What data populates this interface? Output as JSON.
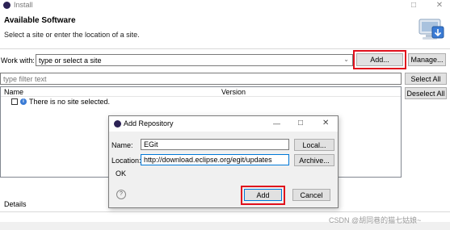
{
  "window": {
    "title": "Install",
    "minimize_glyph": "□",
    "close_glyph": "✕"
  },
  "header": {
    "title": "Available Software",
    "subtitle": "Select a site or enter the location of a site."
  },
  "workwith": {
    "label": "Work with:",
    "value": "type or select a site",
    "add_label": "Add...",
    "manage_label": "Manage..."
  },
  "filter": {
    "placeholder": "type filter text"
  },
  "buttons": {
    "select_all": "Select All",
    "deselect_all": "Deselect All"
  },
  "tree": {
    "columns": [
      "Name",
      "Version"
    ],
    "empty_message": "There is no site selected."
  },
  "dialog": {
    "title": "Add Repository",
    "name_label": "Name:",
    "name_value": "EGit",
    "local_label": "Local...",
    "location_label": "Location:",
    "location_value": "http://download.eclipse.org/egit/updates",
    "archive_label": "Archive...",
    "status": "OK",
    "help_glyph": "?",
    "add_label": "Add",
    "cancel_label": "Cancel",
    "minimize_glyph": "—",
    "maximize_glyph": "□",
    "close_glyph": "✕"
  },
  "details": {
    "label": "Details"
  },
  "watermark": "CSDN @胡同巷的猫七姑娘~"
}
